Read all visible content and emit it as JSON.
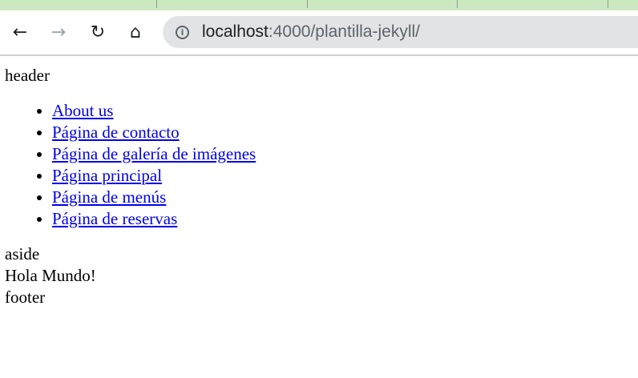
{
  "browser": {
    "url_host": "localhost",
    "url_rest": ":4000/plantilla-jekyll/",
    "icons": [
      "back-arrow-icon",
      "forward-arrow-icon",
      "reload-icon",
      "home-icon",
      "info-icon"
    ]
  },
  "page": {
    "header": "header",
    "nav_links": [
      {
        "label": "About us"
      },
      {
        "label": "Página de contacto"
      },
      {
        "label": "Página de galería de imágenes"
      },
      {
        "label": "Página principal"
      },
      {
        "label": "Página de menús"
      },
      {
        "label": "Página de reservas"
      }
    ],
    "aside": "aside",
    "main": "Hola Mundo!",
    "footer": "footer"
  }
}
